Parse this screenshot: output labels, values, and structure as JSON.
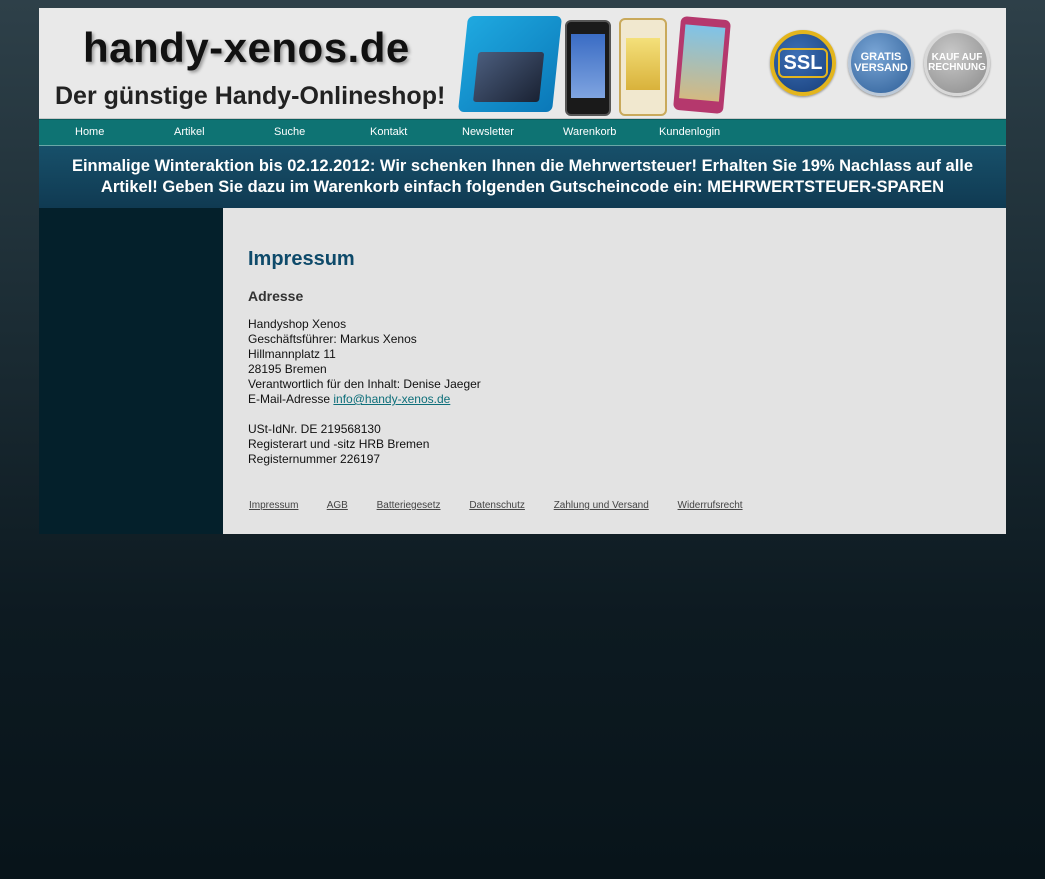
{
  "header": {
    "logo_title": "handy-xenos.de",
    "logo_subtitle": "Der günstige Handy-Onlineshop!",
    "badges": [
      {
        "label": "SSL",
        "ring_text": "DATENSICHERHEIT",
        "icon": "ssl-badge-icon"
      },
      {
        "label": "GRATIS VERSAND",
        "icon": "gratis-versand-badge-icon"
      },
      {
        "label": "KAUF AUF RECHNUNG",
        "icon": "kauf-auf-rechnung-badge-icon"
      }
    ]
  },
  "nav": {
    "items": [
      "Home",
      "Artikel",
      "Suche",
      "Kontakt",
      "Newsletter",
      "Warenkorb",
      "Kundenlogin"
    ]
  },
  "promo": {
    "text": "Einmalige Winteraktion bis 02.12.2012: Wir schenken Ihnen die Mehrwertsteuer! Erhalten Sie 19% Nachlass auf alle Artikel! Geben Sie dazu im Warenkorb einfach folgenden Gutscheincode ein: MEHRWERTSTEUER-SPAREN"
  },
  "page": {
    "title": "Impressum",
    "section": "Adresse",
    "address_lines": [
      "Handyshop Xenos",
      "Geschäftsführer: Markus Xenos",
      "Hillmannplatz 11",
      "28195 Bremen",
      "Verantwortlich für den Inhalt: Denise Jaeger"
    ],
    "email_label": "E-Mail-Adresse",
    "email": "info@handy-xenos.de",
    "legal_lines": [
      "USt-IdNr. DE 219568130",
      "Registerart und -sitz HRB Bremen",
      "Registernummer 226197"
    ]
  },
  "footer": {
    "links": [
      "Impressum",
      "AGB",
      "Batteriegesetz",
      "Datenschutz",
      "Zahlung und Versand",
      "Widerrufsrecht"
    ]
  },
  "colors": {
    "nav_bg": "#0e7373",
    "promo_bg": "#103a52",
    "sidebar_bg": "#04202b",
    "content_bg": "#e3e3e3",
    "title": "#0e4a6a",
    "link": "#0e6f7a"
  }
}
